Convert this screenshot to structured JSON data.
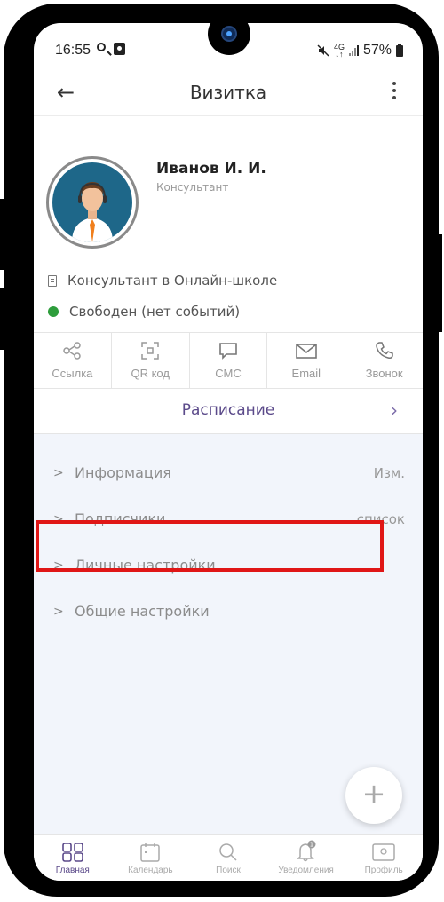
{
  "status": {
    "time": "16:55",
    "net_top": "4G",
    "net_bottom": "↓↑",
    "battery": "57%"
  },
  "appbar": {
    "back_glyph": "←",
    "title": "Визитка"
  },
  "profile": {
    "name": "Иванов И. И.",
    "role": "Консультант",
    "position": "Консультант в Онлайн-школе",
    "status_text": "Свободен (нет событий)",
    "status_color": "#2e9d3c"
  },
  "actions": [
    {
      "label": "Ссылка",
      "icon": "share-icon"
    },
    {
      "label": "QR код",
      "icon": "qr-icon"
    },
    {
      "label": "СМС",
      "icon": "sms-icon"
    },
    {
      "label": "Email",
      "icon": "mail-icon"
    },
    {
      "label": "Звонок",
      "icon": "phone-icon"
    }
  ],
  "schedule": {
    "label": "Расписание",
    "chevron": "›"
  },
  "sections": [
    {
      "label": "Информация",
      "right": "Изм."
    },
    {
      "label": "Подписчики",
      "right": "список"
    },
    {
      "label": "Личные настройки",
      "right": ""
    },
    {
      "label": "Общие настройки",
      "right": ""
    }
  ],
  "fab": {
    "glyph": "+"
  },
  "tabs": [
    {
      "label": "Главная",
      "icon": "grid-icon",
      "active": true
    },
    {
      "label": "Календарь",
      "icon": "calendar-icon",
      "active": false
    },
    {
      "label": "Поиск",
      "icon": "search-icon",
      "active": false
    },
    {
      "label": "Уведомления",
      "icon": "bell-icon",
      "active": false,
      "badge": "1"
    },
    {
      "label": "Профиль",
      "icon": "profile-card-icon",
      "active": false
    }
  ],
  "colors": {
    "accent": "#5b4a8a",
    "highlight": "#e01616",
    "list_bg": "#f2f5fb"
  }
}
